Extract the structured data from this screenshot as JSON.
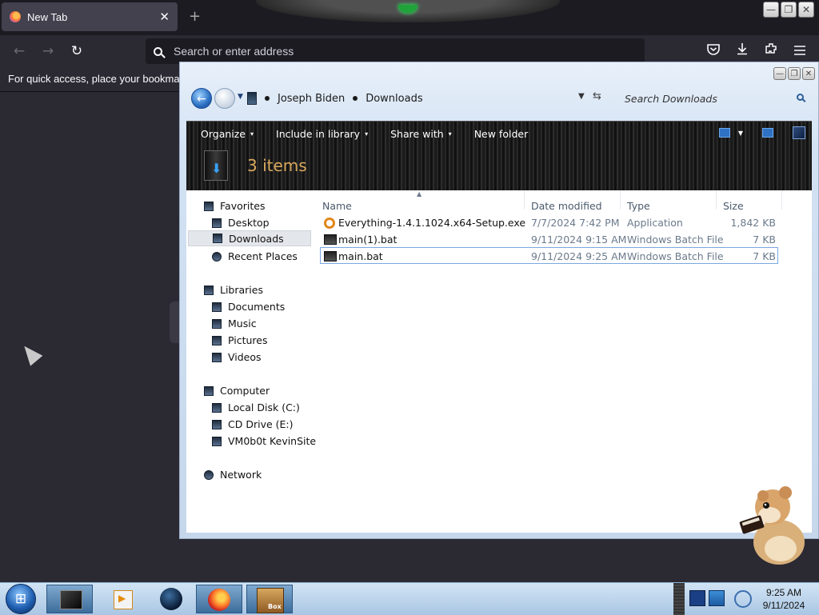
{
  "browser": {
    "tab": {
      "title": "New Tab",
      "close": "✕"
    },
    "new_tab_glyph": "+",
    "nav": {
      "back": "←",
      "forward": "→",
      "reload": "↻"
    },
    "urlbar": {
      "placeholder": "Search or enter address"
    },
    "toolbar_icons": [
      "pocket-icon",
      "download-icon",
      "extensions-icon",
      "menu-icon"
    ],
    "bookmarks_hint": "For quick access, place your bookmarks h",
    "window_controls": [
      "—",
      "❐",
      "✕"
    ]
  },
  "explorer": {
    "breadcrumb": [
      "Joseph Biden",
      "Downloads"
    ],
    "search_placeholder": "Search Downloads",
    "commands": [
      {
        "label": "Organize",
        "caret": "▾"
      },
      {
        "label": "Include in library",
        "caret": "▾"
      },
      {
        "label": "Share with",
        "caret": "▾"
      },
      {
        "label": "New folder"
      }
    ],
    "item_count": "3 items",
    "nav_pane": {
      "favorites": {
        "label": "Favorites",
        "items": [
          "Desktop",
          "Downloads",
          "Recent Places"
        ]
      },
      "libraries": {
        "label": "Libraries",
        "items": [
          "Documents",
          "Music",
          "Pictures",
          "Videos"
        ]
      },
      "computer": {
        "label": "Computer",
        "items": [
          "Local Disk (C:)",
          "CD Drive (E:)",
          "VM0b0t KevinSite"
        ]
      },
      "network": {
        "label": "Network"
      }
    },
    "columns": {
      "name": "Name",
      "date": "Date modified",
      "type": "Type",
      "size": "Size"
    },
    "files": [
      {
        "name": "Everything-1.4.1.1024.x64-Setup.exe",
        "date": "7/7/2024 7:42 PM",
        "type": "Application",
        "size": "1,842 KB",
        "icon": "exe"
      },
      {
        "name": "main(1).bat",
        "date": "9/11/2024 9:15 AM",
        "type": "Windows Batch File",
        "size": "7 KB",
        "icon": "bat"
      },
      {
        "name": "main.bat",
        "date": "9/11/2024 9:25 AM",
        "type": "Windows Batch File",
        "size": "7 KB",
        "icon": "bat"
      }
    ]
  },
  "taskbar": {
    "start_glyph": "⊞",
    "box_label": "Box",
    "clock": {
      "time": "9:25 AM",
      "date": "9/11/2024"
    }
  }
}
